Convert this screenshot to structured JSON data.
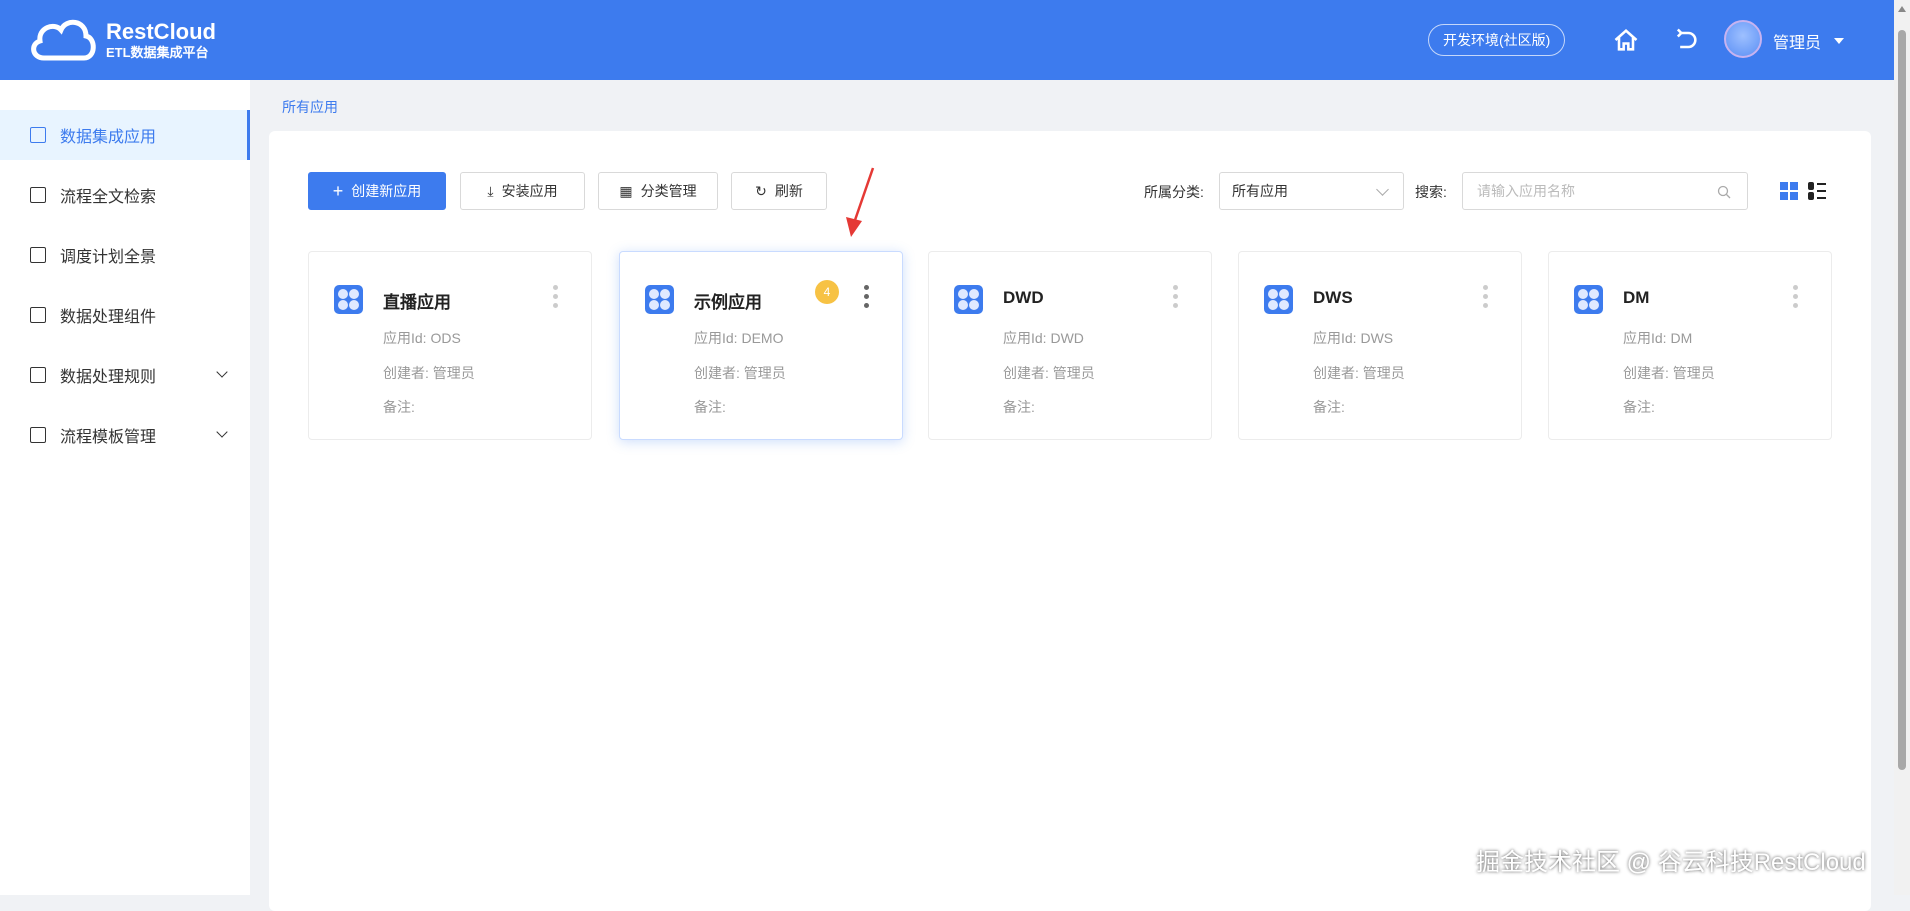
{
  "header": {
    "logo_title": "RestCloud",
    "logo_subtitle": "ETL数据集成平台",
    "env_label": "开发环境(社区版)",
    "user_name": "管理员"
  },
  "sidebar": {
    "items": [
      {
        "label": "数据集成应用",
        "icon": "grid-icon",
        "active": true
      },
      {
        "label": "流程全文检索",
        "icon": "doc-search-icon"
      },
      {
        "label": "调度计划全景",
        "icon": "sliders-icon"
      },
      {
        "label": "数据处理组件",
        "icon": "list-icon"
      },
      {
        "label": "数据处理规则",
        "icon": "terminal-icon",
        "expandable": true
      },
      {
        "label": "流程模板管理",
        "icon": "layout-icon",
        "expandable": true
      }
    ]
  },
  "breadcrumb": "所有应用",
  "toolbar": {
    "create": "创建新应用",
    "install": "安装应用",
    "category": "分类管理",
    "refresh": "刷新",
    "category_label": "所属分类:",
    "category_value": "所有应用",
    "search_label": "搜索:",
    "search_placeholder": "请输入应用名称"
  },
  "cards": [
    {
      "name": "直播应用",
      "id": "应用Id: ODS",
      "creator": "创建者: 管理员",
      "note": "备注:"
    },
    {
      "name": "示例应用",
      "id": "应用Id: DEMO",
      "creator": "创建者: 管理员",
      "note": "备注:",
      "badge": "4"
    },
    {
      "name": "DWD",
      "id": "应用Id: DWD",
      "creator": "创建者: 管理员",
      "note": "备注:"
    },
    {
      "name": "DWS",
      "id": "应用Id: DWS",
      "creator": "创建者: 管理员",
      "note": "备注:"
    },
    {
      "name": "DM",
      "id": "应用Id: DM",
      "creator": "创建者: 管理员",
      "note": "备注:"
    }
  ],
  "watermark": "掘金技术社区 @ 谷云科技RestCloud",
  "colors": {
    "brand": "#3d7bee",
    "badge": "#f7c244",
    "annotation_arrow": "#e53935"
  }
}
